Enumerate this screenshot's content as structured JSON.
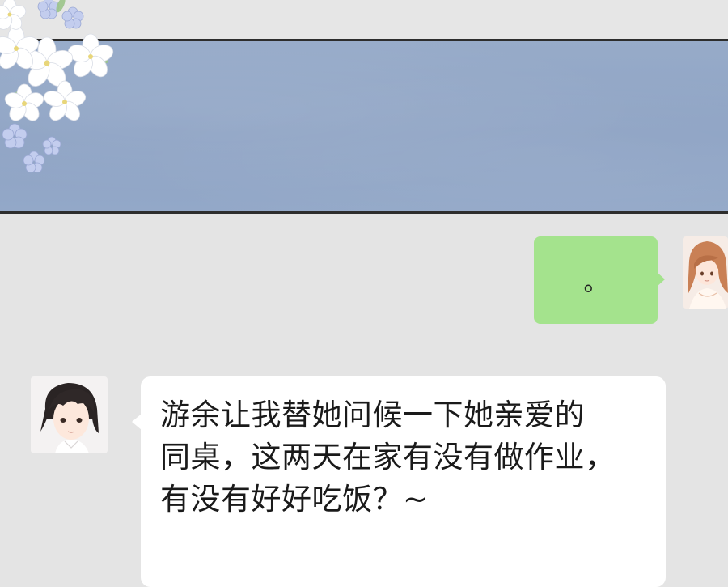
{
  "chat": {
    "messages": [
      {
        "side": "right",
        "sender": "girl",
        "text": "。",
        "bubble_color": "#a4e38d"
      },
      {
        "side": "left",
        "sender": "boy",
        "text": "游余让我替她问候一下她亲爱的\n同桌，这两天在家有没有做作业，\n有没有好好吃饭？~",
        "bubble_color": "#ffffff"
      }
    ]
  },
  "colors": {
    "background": "#e4e4e4",
    "banner": "#8ea3c4",
    "banner_border": "#2d2d2d"
  },
  "icons": {
    "banner_decoration": "white-blossom-flowers",
    "girl_avatar": "girl-avatar",
    "boy_avatar": "boy-avatar"
  }
}
